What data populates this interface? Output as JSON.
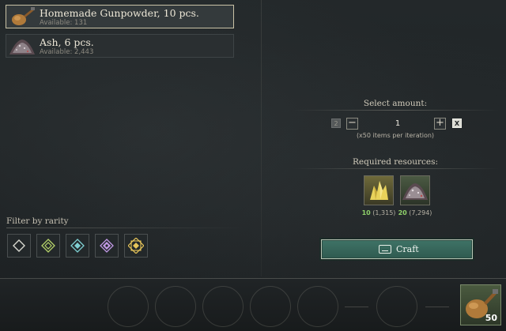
{
  "recipes": [
    {
      "name": "Homemade Gunpowder, 10 pcs.",
      "available": "Available: 131",
      "icon": "gunpowder-flask-icon",
      "selected": true
    },
    {
      "name": "Ash, 6 pcs.",
      "available": "Available: 2,443",
      "icon": "ash-pile-icon",
      "selected": false
    }
  ],
  "filter": {
    "title": "Filter by rarity",
    "rarities": [
      {
        "icon": "rarity-common-icon",
        "color": "#d8d8d0"
      },
      {
        "icon": "rarity-uncommon-icon",
        "color": "#b6d36a"
      },
      {
        "icon": "rarity-rare-icon",
        "color": "#7fd0d2"
      },
      {
        "icon": "rarity-epic-icon",
        "color": "#c29ae6"
      },
      {
        "icon": "rarity-legendary-icon",
        "color": "#e6c45a"
      }
    ]
  },
  "amount": {
    "title": "Select amount:",
    "min_label": "2",
    "minus": "−",
    "value": "1",
    "plus": "+",
    "max_label": "X",
    "note": "(x50 items per iteration)"
  },
  "resources": {
    "title": "Required resources:",
    "items": [
      {
        "icon": "sulfur-crystal-icon",
        "required": "10",
        "total": "(1,315)",
        "color": "#e8d25a"
      },
      {
        "icon": "ash-pile-icon",
        "required": "20",
        "total": "(7,294)",
        "color": "#b9b2b8"
      }
    ]
  },
  "craft": {
    "label": "Craft",
    "key_icon": "spacebar-key-icon"
  },
  "result": {
    "count": "50",
    "icon": "gunpowder-flask-icon"
  }
}
